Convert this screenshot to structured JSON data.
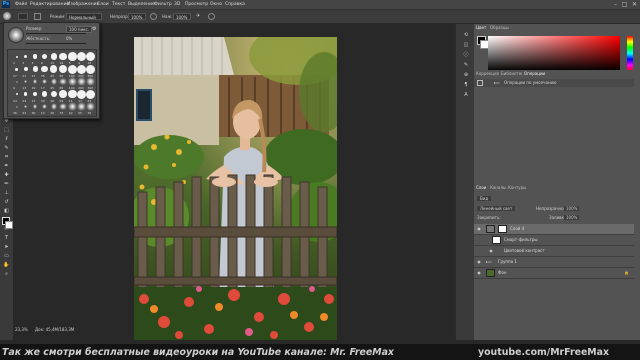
{
  "app": {
    "logo": "Ps"
  },
  "menu": [
    "Файл",
    "Редактирование",
    "Изображение",
    "Слои",
    "Текст",
    "Выделение",
    "Фильтр",
    "3D",
    "Просмотр",
    "Окно",
    "Справка"
  ],
  "options": {
    "mode_label": "Режим:",
    "mode_value": "Нормальный",
    "opacity_label": "Непрозр.:",
    "opacity_value": "100%",
    "flow_label": "Наж.:",
    "flow_value": "100%"
  },
  "brush_popup": {
    "size_label": "Размер:",
    "size_value": "100 пикс.",
    "hardness_label": "Жёсткость:",
    "hardness_value": "0%",
    "presets": [
      "1",
      "3",
      "5",
      "9",
      "13",
      "19",
      "5",
      "9",
      "13",
      "17",
      "21",
      "27",
      "35",
      "45",
      "65",
      "100",
      "200",
      "300",
      "9",
      "13",
      "19",
      "17",
      "45",
      "65",
      "100",
      "200",
      "300",
      "14",
      "24",
      "27",
      "39",
      "46",
      "59",
      "11",
      "17",
      "23",
      "36",
      "44",
      "60",
      "14",
      "26",
      "33",
      "42",
      "55",
      "70"
    ]
  },
  "status": {
    "zoom": "23,3%",
    "doc_info": "Док: 45,4М/183,3М"
  },
  "color_panel": {
    "tabs": [
      "Цвет",
      "Образцы"
    ],
    "fg_color": "#000000",
    "bg_color": "#ffffff"
  },
  "adjust_panel": {
    "tabs": [
      "Коррекция",
      "Библиотеки",
      "Операции"
    ],
    "item": "Операции по умолчанию"
  },
  "layers_panel": {
    "tabs": [
      "Слои",
      "Каналы",
      "Контуры"
    ],
    "kind_label": "Вид",
    "blend_mode": "Линейный свет",
    "opacity_label": "Непрозрачность:",
    "opacity_value": "100%",
    "lock_label": "Закрепить:",
    "fill_label": "Заливка:",
    "fill_value": "100%",
    "layers": [
      {
        "name": "Слой 4"
      },
      {
        "name": "Смарт-фильтры"
      },
      {
        "name": "Цветовой контраст"
      },
      {
        "name": "Группа 1"
      },
      {
        "name": "Фон"
      }
    ]
  },
  "watermark": {
    "left": "Так же смотри бесплатные видеоуроки на YouTube канале: Mr. FreeMax",
    "right": "youtube.com/MrFreeMax"
  }
}
